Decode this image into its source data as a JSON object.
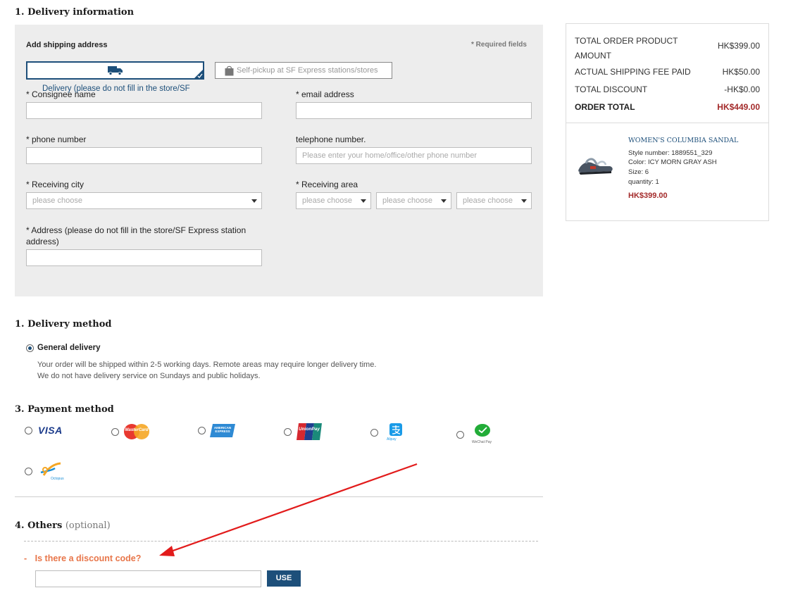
{
  "sections": {
    "delivery_info": "1. Delivery information",
    "delivery_method": "1. Delivery method",
    "payment_method": "3. Payment method",
    "others": "4. Others",
    "others_optional": "(optional)"
  },
  "form": {
    "add_shipping_title": "Add shipping address",
    "required_note": "* Required fields",
    "tab_delivery_label": "Delivery (please do not fill in the store/SF",
    "tab_pickup_label": "Self-pickup at SF Express stations/stores",
    "consignee_label": "* Consignee name",
    "email_label": "* email address",
    "phone_label": "* phone number",
    "telephone_label": "telephone number.",
    "telephone_placeholder": "Please enter your home/office/other phone number",
    "city_label": "* Receiving city",
    "city_select": "please choose",
    "area_label": "* Receiving area",
    "area_select_1": "please choose",
    "area_select_2": "please choose",
    "area_select_3": "please choose",
    "address_label": "* Address (please do not fill in the store/SF Express station address)"
  },
  "delivery_method": {
    "option": "General delivery",
    "note_line1": "Your order will be shipped within 2-5 working days. Remote areas may require longer delivery time.",
    "note_line2": "We do not have delivery service on Sundays and public holidays."
  },
  "payment": {
    "visa": "VISA",
    "mastercard": "MasterCard",
    "amex": "AMERICAN EXPRESS",
    "unionpay": "UnionPay",
    "alipay": "Alipay",
    "wechat": "WeChat Pay",
    "octopus": "Octopus"
  },
  "discount": {
    "toggle": "Is there a discount code?",
    "dash": "-",
    "button": "USE"
  },
  "summary": {
    "product_amount_label": "TOTAL ORDER PRODUCT AMOUNT",
    "product_amount_value": "HK$399.00",
    "shipping_label": "ACTUAL SHIPPING FEE PAID",
    "shipping_value": "HK$50.00",
    "discount_label": "TOTAL DISCOUNT",
    "discount_value": "-HK$0.00",
    "total_label": "ORDER TOTAL",
    "total_value": "HK$449.00",
    "accent_color": "#a32a2a"
  },
  "product": {
    "name": "WOMEN'S COLUMBIA SANDAL",
    "style": "Style number: 1889551_329",
    "color": "Color: ICY MORN GRAY ASH",
    "size": "Size: 6",
    "quantity": "quantity: 1",
    "price": "HK$399.00"
  },
  "colors": {
    "brand_blue": "#1d4f7a",
    "discount_orange": "#e8764a",
    "annotation_red": "#e21b1b"
  }
}
